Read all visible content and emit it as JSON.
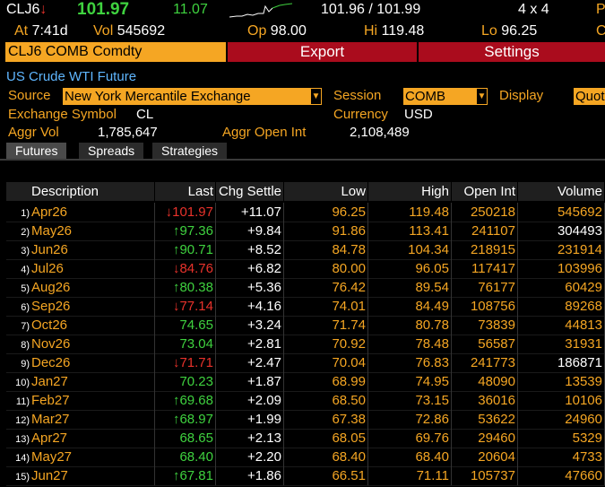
{
  "header": {
    "ticker": "CLJ6",
    "ticker_arrow": "↓",
    "last_price": "101.97",
    "net_change": "11.07",
    "bid_ask": "101.96 / 101.99",
    "size": "4 x 4",
    "edge_top": "P",
    "at_label": "At",
    "at_time": "7:41d",
    "vol_label": "Vol",
    "vol_value": "545692",
    "open_label": "Op",
    "open_value": "98.00",
    "hi_label": "Hi",
    "hi_value": "119.48",
    "lo_label": "Lo",
    "lo_value": "96.25",
    "edge_bottom": "C"
  },
  "command_bar": {
    "input_value": "CLJ6 COMB Comdty",
    "export_label": "Export",
    "settings_label": "Settings"
  },
  "security": {
    "name": "US Crude WTI Future",
    "source_label": "Source",
    "source_value": "New York Mercantile Exchange",
    "session_label": "Session",
    "session_value": "COMB",
    "display_label": "Display",
    "display_value": "Quot",
    "exchange_symbol_label": "Exchange Symbol",
    "exchange_symbol_value": "CL",
    "currency_label": "Currency",
    "currency_value": "USD",
    "aggr_vol_label": "Aggr Vol",
    "aggr_vol_value": "1,785,647",
    "aggr_oi_label": "Aggr Open Int",
    "aggr_oi_value": "2,108,489"
  },
  "tabs": [
    {
      "label": "Futures",
      "active": true
    },
    {
      "label": "Spreads",
      "active": false
    },
    {
      "label": "Strategies",
      "active": false
    }
  ],
  "table": {
    "columns": [
      "Description",
      "Last",
      "Chg Settle",
      "Low",
      "High",
      "Open Int",
      "Volume"
    ],
    "rows": [
      {
        "num": "1)",
        "desc": "Apr26",
        "arrow": "↓",
        "last": "101.97",
        "chg": "+11.07",
        "low": "96.25",
        "high": "119.48",
        "oi": "250218",
        "vol": "545692",
        "vol_white": false
      },
      {
        "num": "2)",
        "desc": "May26",
        "arrow": "↑",
        "last": "97.36",
        "chg": "+9.84",
        "low": "91.86",
        "high": "113.41",
        "oi": "241107",
        "vol": "304493",
        "vol_white": true
      },
      {
        "num": "3)",
        "desc": "Jun26",
        "arrow": "↑",
        "last": "90.71",
        "chg": "+8.52",
        "low": "84.78",
        "high": "104.34",
        "oi": "218915",
        "vol": "231914",
        "vol_white": false
      },
      {
        "num": "4)",
        "desc": "Jul26",
        "arrow": "↓",
        "last": "84.76",
        "chg": "+6.82",
        "low": "80.00",
        "high": "96.05",
        "oi": "117417",
        "vol": "103996",
        "vol_white": false
      },
      {
        "num": "5)",
        "desc": "Aug26",
        "arrow": "↑",
        "last": "80.38",
        "chg": "+5.36",
        "low": "76.42",
        "high": "89.54",
        "oi": "76177",
        "vol": "60429",
        "vol_white": false
      },
      {
        "num": "6)",
        "desc": "Sep26",
        "arrow": "↓",
        "last": "77.14",
        "chg": "+4.16",
        "low": "74.01",
        "high": "84.49",
        "oi": "108756",
        "vol": "89268",
        "vol_white": false
      },
      {
        "num": "7)",
        "desc": "Oct26",
        "arrow": "",
        "last": "74.65",
        "chg": "+3.24",
        "low": "71.74",
        "high": "80.78",
        "oi": "73839",
        "vol": "44813",
        "vol_white": false
      },
      {
        "num": "8)",
        "desc": "Nov26",
        "arrow": "",
        "last": "73.04",
        "chg": "+2.81",
        "low": "70.92",
        "high": "78.48",
        "oi": "56587",
        "vol": "31931",
        "vol_white": false
      },
      {
        "num": "9)",
        "desc": "Dec26",
        "arrow": "↓",
        "last": "71.71",
        "chg": "+2.47",
        "low": "70.04",
        "high": "76.83",
        "oi": "241773",
        "vol": "186871",
        "vol_white": true
      },
      {
        "num": "10)",
        "desc": "Jan27",
        "arrow": "",
        "last": "70.23",
        "chg": "+1.87",
        "low": "68.99",
        "high": "74.95",
        "oi": "48090",
        "vol": "13539",
        "vol_white": false
      },
      {
        "num": "11)",
        "desc": "Feb27",
        "arrow": "↑",
        "last": "69.68",
        "chg": "+2.09",
        "low": "68.50",
        "high": "73.15",
        "oi": "36016",
        "vol": "10106",
        "vol_white": false
      },
      {
        "num": "12)",
        "desc": "Mar27",
        "arrow": "↑",
        "last": "68.97",
        "chg": "+1.99",
        "low": "67.38",
        "high": "72.86",
        "oi": "53622",
        "vol": "24960",
        "vol_white": false
      },
      {
        "num": "13)",
        "desc": "Apr27",
        "arrow": "",
        "last": "68.65",
        "chg": "+2.13",
        "low": "68.05",
        "high": "69.76",
        "oi": "29460",
        "vol": "5329",
        "vol_white": false
      },
      {
        "num": "14)",
        "desc": "May27",
        "arrow": "",
        "last": "68.40",
        "chg": "+2.20",
        "low": "68.40",
        "high": "68.40",
        "oi": "20604",
        "vol": "4733",
        "vol_white": false
      },
      {
        "num": "15)",
        "desc": "Jun27",
        "arrow": "↑",
        "last": "67.81",
        "chg": "+1.86",
        "low": "66.51",
        "high": "71.11",
        "oi": "105737",
        "vol": "47660",
        "vol_white": false
      }
    ]
  },
  "colors": {
    "background": "#000000",
    "amber": "#f5a623",
    "up": "#3fd23f",
    "down": "#e8322b",
    "button_red": "#aa0c1d",
    "title_blue": "#5fb6ff"
  }
}
